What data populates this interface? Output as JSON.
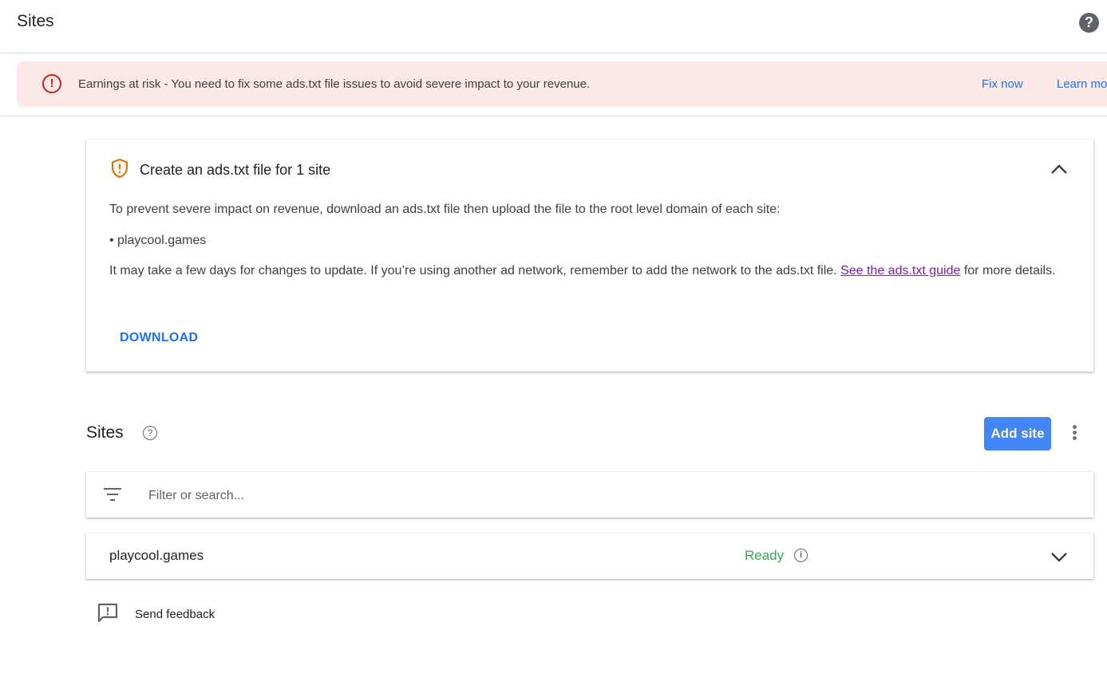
{
  "header": {
    "title": "Sites",
    "help_icon": "help-circle-icon"
  },
  "banner": {
    "icon": "error-circle-icon",
    "message": "Earnings at risk - You need to fix some ads.txt file issues to avoid severe impact to your revenue.",
    "fix_now_label": "Fix now",
    "learn_more_label": "Learn more"
  },
  "ads_card": {
    "icon": "shield-alert-icon",
    "heading": "Create an ads.txt file for 1 site",
    "instruction": "To prevent severe impact on revenue, download an ads.txt file then upload the file to the root level domain of each site:",
    "sites": [
      "playcool.games"
    ],
    "note_before_link": "It may take a few days for changes to update. If you’re using another ad network, remember to add the network to the ads.txt file. ",
    "guide_link_label": "See the ads.txt guide",
    "note_after_link": " for more details.",
    "download_label": "DOWNLOAD",
    "collapse_icon": "chevron-up-icon"
  },
  "sites_section": {
    "title": "Sites",
    "add_site_label": "Add site",
    "more_icon": "more-vert-icon",
    "filter": {
      "placeholder": "Filter or search...",
      "value": ""
    },
    "rows": [
      {
        "name": "playcool.games",
        "status": "Ready"
      }
    ]
  },
  "feedback": {
    "label": "Send feedback"
  },
  "colors": {
    "banner_bg": "#fce8e6",
    "error_red": "#c5221f",
    "link_blue": "#1a73e8",
    "visited_link": "#7b1fa2",
    "primary_button": "#4285f4",
    "status_green": "#34a853",
    "warning_orange": "#e37400"
  }
}
